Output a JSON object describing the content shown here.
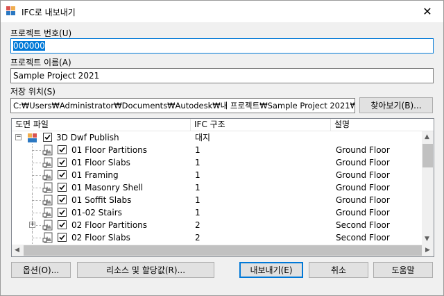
{
  "window": {
    "title": "IFC로 내보내기"
  },
  "project_number": {
    "label": "프로젝트 번호(U)",
    "value": "000000"
  },
  "project_name": {
    "label": "프로젝트 이름(A)",
    "value": "Sample Project 2021"
  },
  "save_location": {
    "label": "저장 위치(S)",
    "value": "C:₩Users₩Administrator₩Documents₩Autodesk₩내 프로젝트₩Sample Project 2021₩",
    "browse_label": "찾아보기(B)..."
  },
  "grid": {
    "columns": [
      "도면 파일",
      "IFC 구조",
      "설명"
    ],
    "rows": [
      {
        "name": "3D Dwf Publish",
        "ifc": "대지",
        "desc": "",
        "level": 0,
        "expander": "−"
      },
      {
        "name": "01 Floor Partitions",
        "ifc": "1",
        "desc": "Ground Floor",
        "level": 1,
        "expander": ""
      },
      {
        "name": "01 Floor Slabs",
        "ifc": "1",
        "desc": "Ground Floor",
        "level": 1,
        "expander": ""
      },
      {
        "name": "01 Framing",
        "ifc": "1",
        "desc": "Ground Floor",
        "level": 1,
        "expander": ""
      },
      {
        "name": "01 Masonry Shell",
        "ifc": "1",
        "desc": "Ground Floor",
        "level": 1,
        "expander": ""
      },
      {
        "name": "01 Soffit Slabs",
        "ifc": "1",
        "desc": "Ground Floor",
        "level": 1,
        "expander": ""
      },
      {
        "name": "01-02 Stairs",
        "ifc": "1",
        "desc": "Ground Floor",
        "level": 1,
        "expander": ""
      },
      {
        "name": "02 Floor Partitions",
        "ifc": "2",
        "desc": "Second Floor",
        "level": 1,
        "expander": "+"
      },
      {
        "name": "02 Floor Slabs",
        "ifc": "2",
        "desc": "Second Floor",
        "level": 1,
        "expander": ""
      }
    ]
  },
  "buttons": {
    "options": "옵션(O)...",
    "resources": "리소스 및 할당값(R)...",
    "export": "내보내기(E)",
    "cancel": "취소",
    "help": "도움말"
  },
  "colors": {
    "accent": "#0078d7",
    "selection": "#0078d7"
  }
}
